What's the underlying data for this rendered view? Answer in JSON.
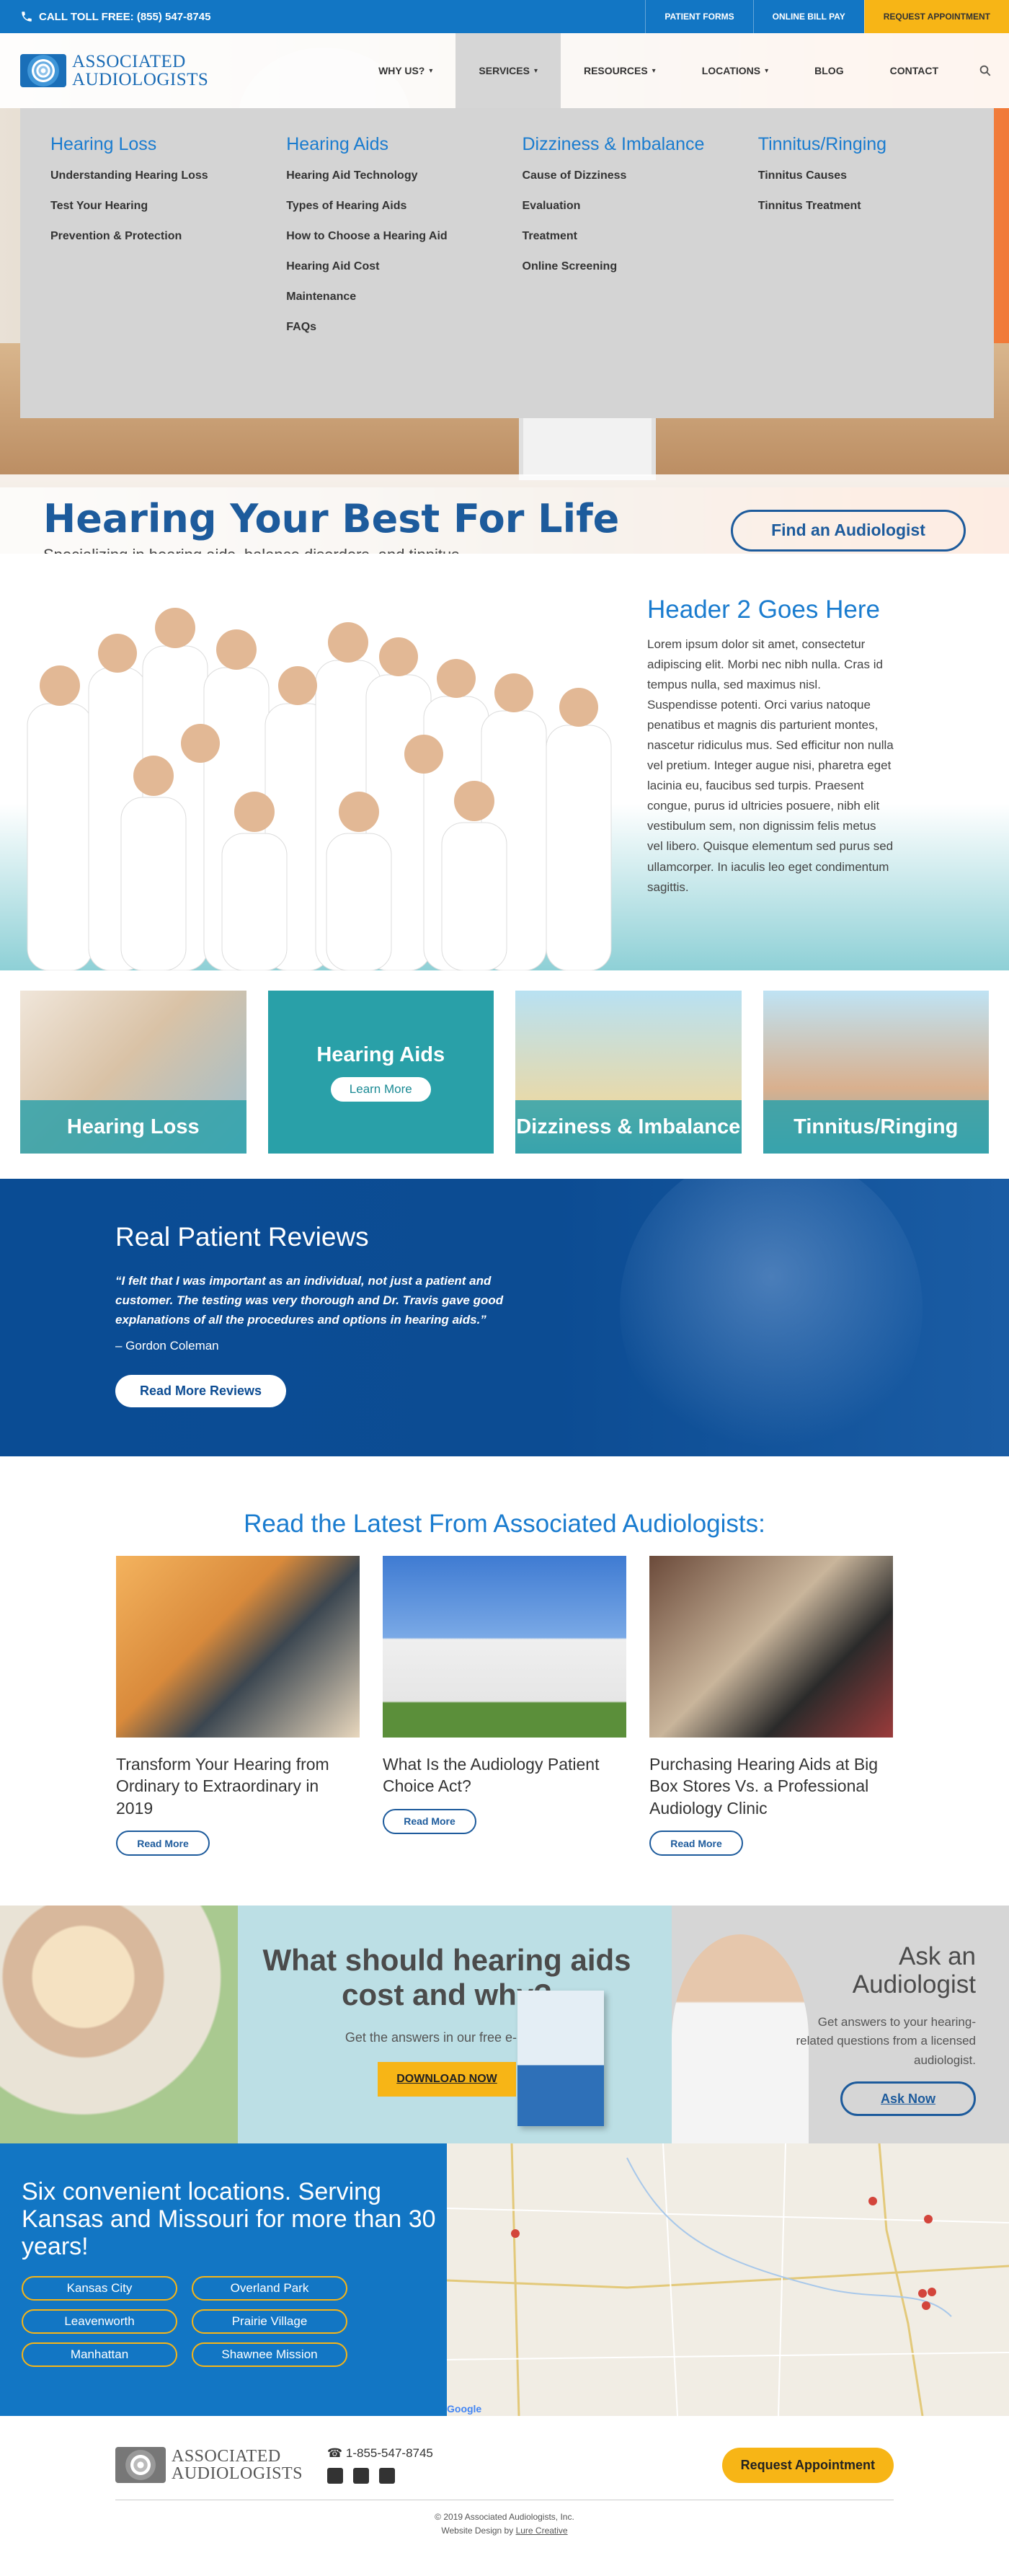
{
  "topbar": {
    "toll": "CALL TOLL FREE: (855) 547-8745",
    "links": [
      "PATIENT FORMS",
      "ONLINE BILL PAY",
      "REQUEST APPOINTMENT"
    ]
  },
  "logo": {
    "line1": "ASSOCIATED",
    "line2": "AUDIOLOGISTS"
  },
  "nav": {
    "items": [
      "WHY US?",
      "SERVICES",
      "RESOURCES",
      "LOCATIONS",
      "BLOG",
      "CONTACT"
    ]
  },
  "mega": {
    "cols": [
      {
        "title": "Hearing Loss",
        "links": [
          "Understanding Hearing Loss",
          "Test Your Hearing",
          "Prevention & Protection"
        ]
      },
      {
        "title": "Hearing Aids",
        "links": [
          "Hearing Aid Technology",
          "Types of Hearing Aids",
          "How to Choose a Hearing Aid",
          "Hearing Aid Cost",
          "Maintenance",
          "FAQs"
        ]
      },
      {
        "title": "Dizziness & Imbalance",
        "links": [
          "Cause of Dizziness",
          "Evaluation",
          "Treatment",
          "Online Screening"
        ]
      },
      {
        "title": "Tinnitus/Ringing",
        "links": [
          "Tinnitus Causes",
          "Tinnitus Treatment"
        ]
      }
    ]
  },
  "hero": {
    "title": "Hearing Your Best For Life",
    "subtitle": "Specializing in hearing aids, balance disorders, and tinnitus.",
    "button": "Find an Audiologist"
  },
  "team": {
    "heading": "Header 2 Goes Here",
    "body": "Lorem ipsum dolor sit amet, consectetur adipiscing elit. Morbi nec nibh nulla. Cras id tempus nulla, sed maximus nisl. Suspendisse potenti. Orci varius natoque penatibus et magnis dis parturient montes, nascetur ridiculus mus. Sed efficitur non nulla vel pretium. Integer augue nisi, pharetra eget lacinia eu, faucibus sed turpis. Praesent congue, purus id ultricies posuere, nibh elit vestibulum sem, non dignissim felis metus vel libero. Quisque elementum sed purus sed ullamcorper. In iaculis leo eget condimentum sagittis."
  },
  "tiles": [
    {
      "label": "Hearing Loss"
    },
    {
      "label": "Hearing Aids",
      "button": "Learn More"
    },
    {
      "label": "Dizziness & Imbalance"
    },
    {
      "label": "Tinnitus/Ringing"
    }
  ],
  "reviews": {
    "heading": "Real Patient Reviews",
    "quote": "“I felt that I was important as an individual, not just a patient and customer. The testing was very thorough and Dr. Travis gave good explanations of all the procedures and options in hearing aids.”",
    "author": "– Gordon Coleman",
    "button": "Read More Reviews"
  },
  "blog": {
    "heading": "Read the Latest From Associated Audiologists:",
    "posts": [
      {
        "title": "Transform Your Hearing from Ordinary to Extraordinary in 2019",
        "button": "Read More"
      },
      {
        "title": "What Is the Audiology Patient Choice Act?",
        "button": "Read More"
      },
      {
        "title": "Purchasing Hearing Aids at Big Box Stores Vs. a Professional Audiology Clinic",
        "button": "Read More"
      }
    ]
  },
  "cost": {
    "heading": "What should hearing aids cost and why?",
    "sub": "Get the answers in our free e-book.",
    "button": "DOWNLOAD NOW"
  },
  "ask": {
    "heading": "Ask an Audiologist",
    "body": "Get answers to your hearing-related questions from a licensed audiologist.",
    "button": "Ask Now"
  },
  "locations": {
    "heading": "Six convenient locations. Serving Kansas and Missouri for more than 30 years!",
    "items": [
      "Kansas City",
      "Overland Park",
      "Leavenworth",
      "Prairie Village",
      "Manhattan",
      "Shawnee Mission"
    ]
  },
  "map": {
    "google": "Google"
  },
  "footer": {
    "logo1": "ASSOCIATED",
    "logo2": "AUDIOLOGISTS",
    "phone": "1-855-547-8745",
    "cta": "Request Appointment",
    "copyright": "© 2019 Associated Audiologists, Inc.",
    "credit_prefix": "Website Design by ",
    "credit_link": "Lure Creative"
  },
  "colors": {
    "brand_blue": "#1276c4",
    "navy": "#0c4c93",
    "accent": "#f7b516",
    "teal": "#29a0a8"
  }
}
